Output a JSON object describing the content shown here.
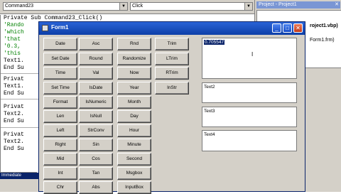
{
  "editor": {
    "object_combo": "Command23",
    "proc_combo": "Click",
    "lines": [
      "Private Sub Command23_Click()",
      "'Rando",
      "'which",
      "'that",
      "'0.3,",
      "'this",
      "Text1.",
      "End Su",
      "Privat",
      "Text1.",
      "End Su",
      "Privat",
      "Text2.",
      "End Su",
      "Privat",
      "Text2.",
      "End Su"
    ]
  },
  "immediate": {
    "title": "Immediate"
  },
  "project": {
    "title": "Project - Project1",
    "tree": [
      "roject1.vbp)",
      "Form1.frm)"
    ]
  },
  "form": {
    "title": "Form1",
    "buttons": {
      "col1": [
        "Date",
        "Set Date",
        "Time",
        "Set Time",
        "Format",
        "Len",
        "Left",
        "Right",
        "Mid",
        "Int",
        "Chr"
      ],
      "col2": [
        "Asc",
        "Round",
        "Val",
        "IsDate",
        "IsNumeric",
        "IsNull",
        "StrConv",
        "Sin",
        "Cos",
        "Tan",
        "Abs"
      ],
      "col3": [
        "Rnd",
        "Randomize",
        "Now",
        "Year",
        "Month",
        "Day",
        "Hour",
        "Minute",
        "Second",
        "Msgbox",
        "InputBox"
      ],
      "col4": [
        "Trim",
        "LTrim",
        "RTrim",
        "InStr"
      ]
    },
    "textboxes": [
      "0.705547",
      "Text2",
      "Text3",
      "Text4"
    ]
  }
}
